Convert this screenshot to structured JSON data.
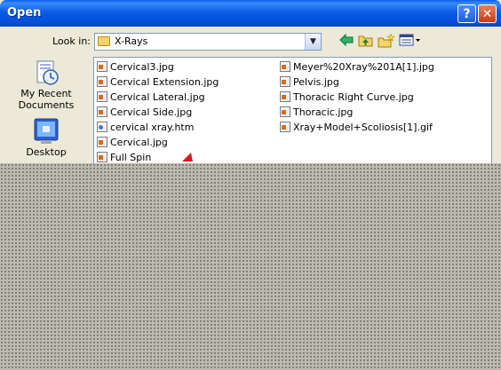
{
  "dialog": {
    "title": "Open",
    "help_label": "?",
    "close_label": "✕"
  },
  "lookin": {
    "label": "Look in:",
    "value": "X-Rays"
  },
  "toolbar": {
    "back_icon": "back-arrow-icon",
    "up_icon": "up-folder-icon",
    "newfolder_icon": "new-folder-icon",
    "views_icon": "views-menu-icon"
  },
  "places": [
    {
      "label": "My Recent Documents",
      "icon": "recent-documents-icon"
    },
    {
      "label": "Desktop",
      "icon": "desktop-icon"
    }
  ],
  "files": {
    "col1": [
      "Cervical3.jpg",
      "Cervical Extension.jpg",
      "Cervical Lateral.jpg",
      "Cervical Side.jpg",
      "cervical xray.htm",
      "Cervical.jpg",
      "Full Spin"
    ],
    "col2": [
      "Meyer%20Xray%201A[1].jpg",
      "Pelvis.jpg",
      "Thoracic Right Curve.jpg",
      "Thoracic.jpg",
      "Xray+Model+Scoliosis[1].gif"
    ]
  }
}
